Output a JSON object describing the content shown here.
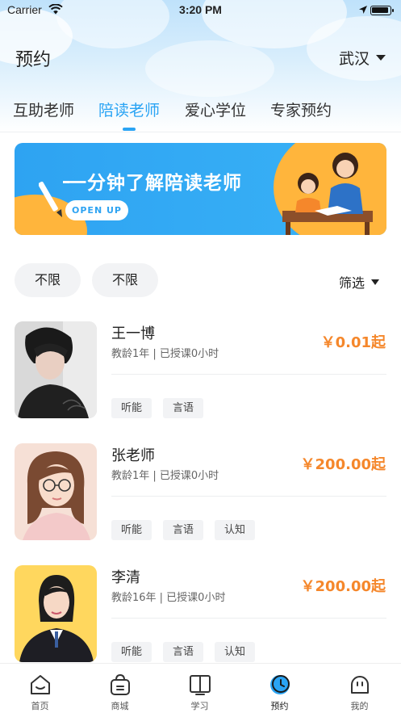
{
  "status_bar": {
    "carrier": "Carrier",
    "time": "3:20 PM"
  },
  "header": {
    "title": "预约",
    "city": "武汉"
  },
  "tabs": [
    {
      "label": "互助老师",
      "active": false
    },
    {
      "label": "陪读老师",
      "active": true
    },
    {
      "label": "爱心学位",
      "active": false
    },
    {
      "label": "专家预约",
      "active": false
    }
  ],
  "banner": {
    "title": "一分钟了解陪读老师",
    "button": "OPEN UP"
  },
  "filters": {
    "chip1": "不限",
    "chip2": "不限",
    "filter_label": "筛选"
  },
  "teachers": [
    {
      "name": "王一博",
      "meta": "教龄1年 | 已授课0小时",
      "price": "￥0.01起",
      "tags": [
        "听能",
        "言语"
      ]
    },
    {
      "name": "张老师",
      "meta": "教龄1年 | 已授课0小时",
      "price": "￥200.00起",
      "tags": [
        "听能",
        "言语",
        "认知"
      ]
    },
    {
      "name": "李清",
      "meta": "教龄16年 | 已授课0小时",
      "price": "￥200.00起",
      "tags": [
        "听能",
        "言语",
        "认知"
      ]
    }
  ],
  "tabbar": [
    {
      "label": "首页",
      "icon": "home-icon"
    },
    {
      "label": "商城",
      "icon": "shop-bag-icon"
    },
    {
      "label": "学习",
      "icon": "book-icon"
    },
    {
      "label": "预约",
      "icon": "clock-icon",
      "active": true
    },
    {
      "label": "我的",
      "icon": "profile-face-icon"
    }
  ],
  "colors": {
    "accent": "#2aa4f4",
    "price": "#f5872b",
    "banner_orange": "#ffb53c"
  }
}
